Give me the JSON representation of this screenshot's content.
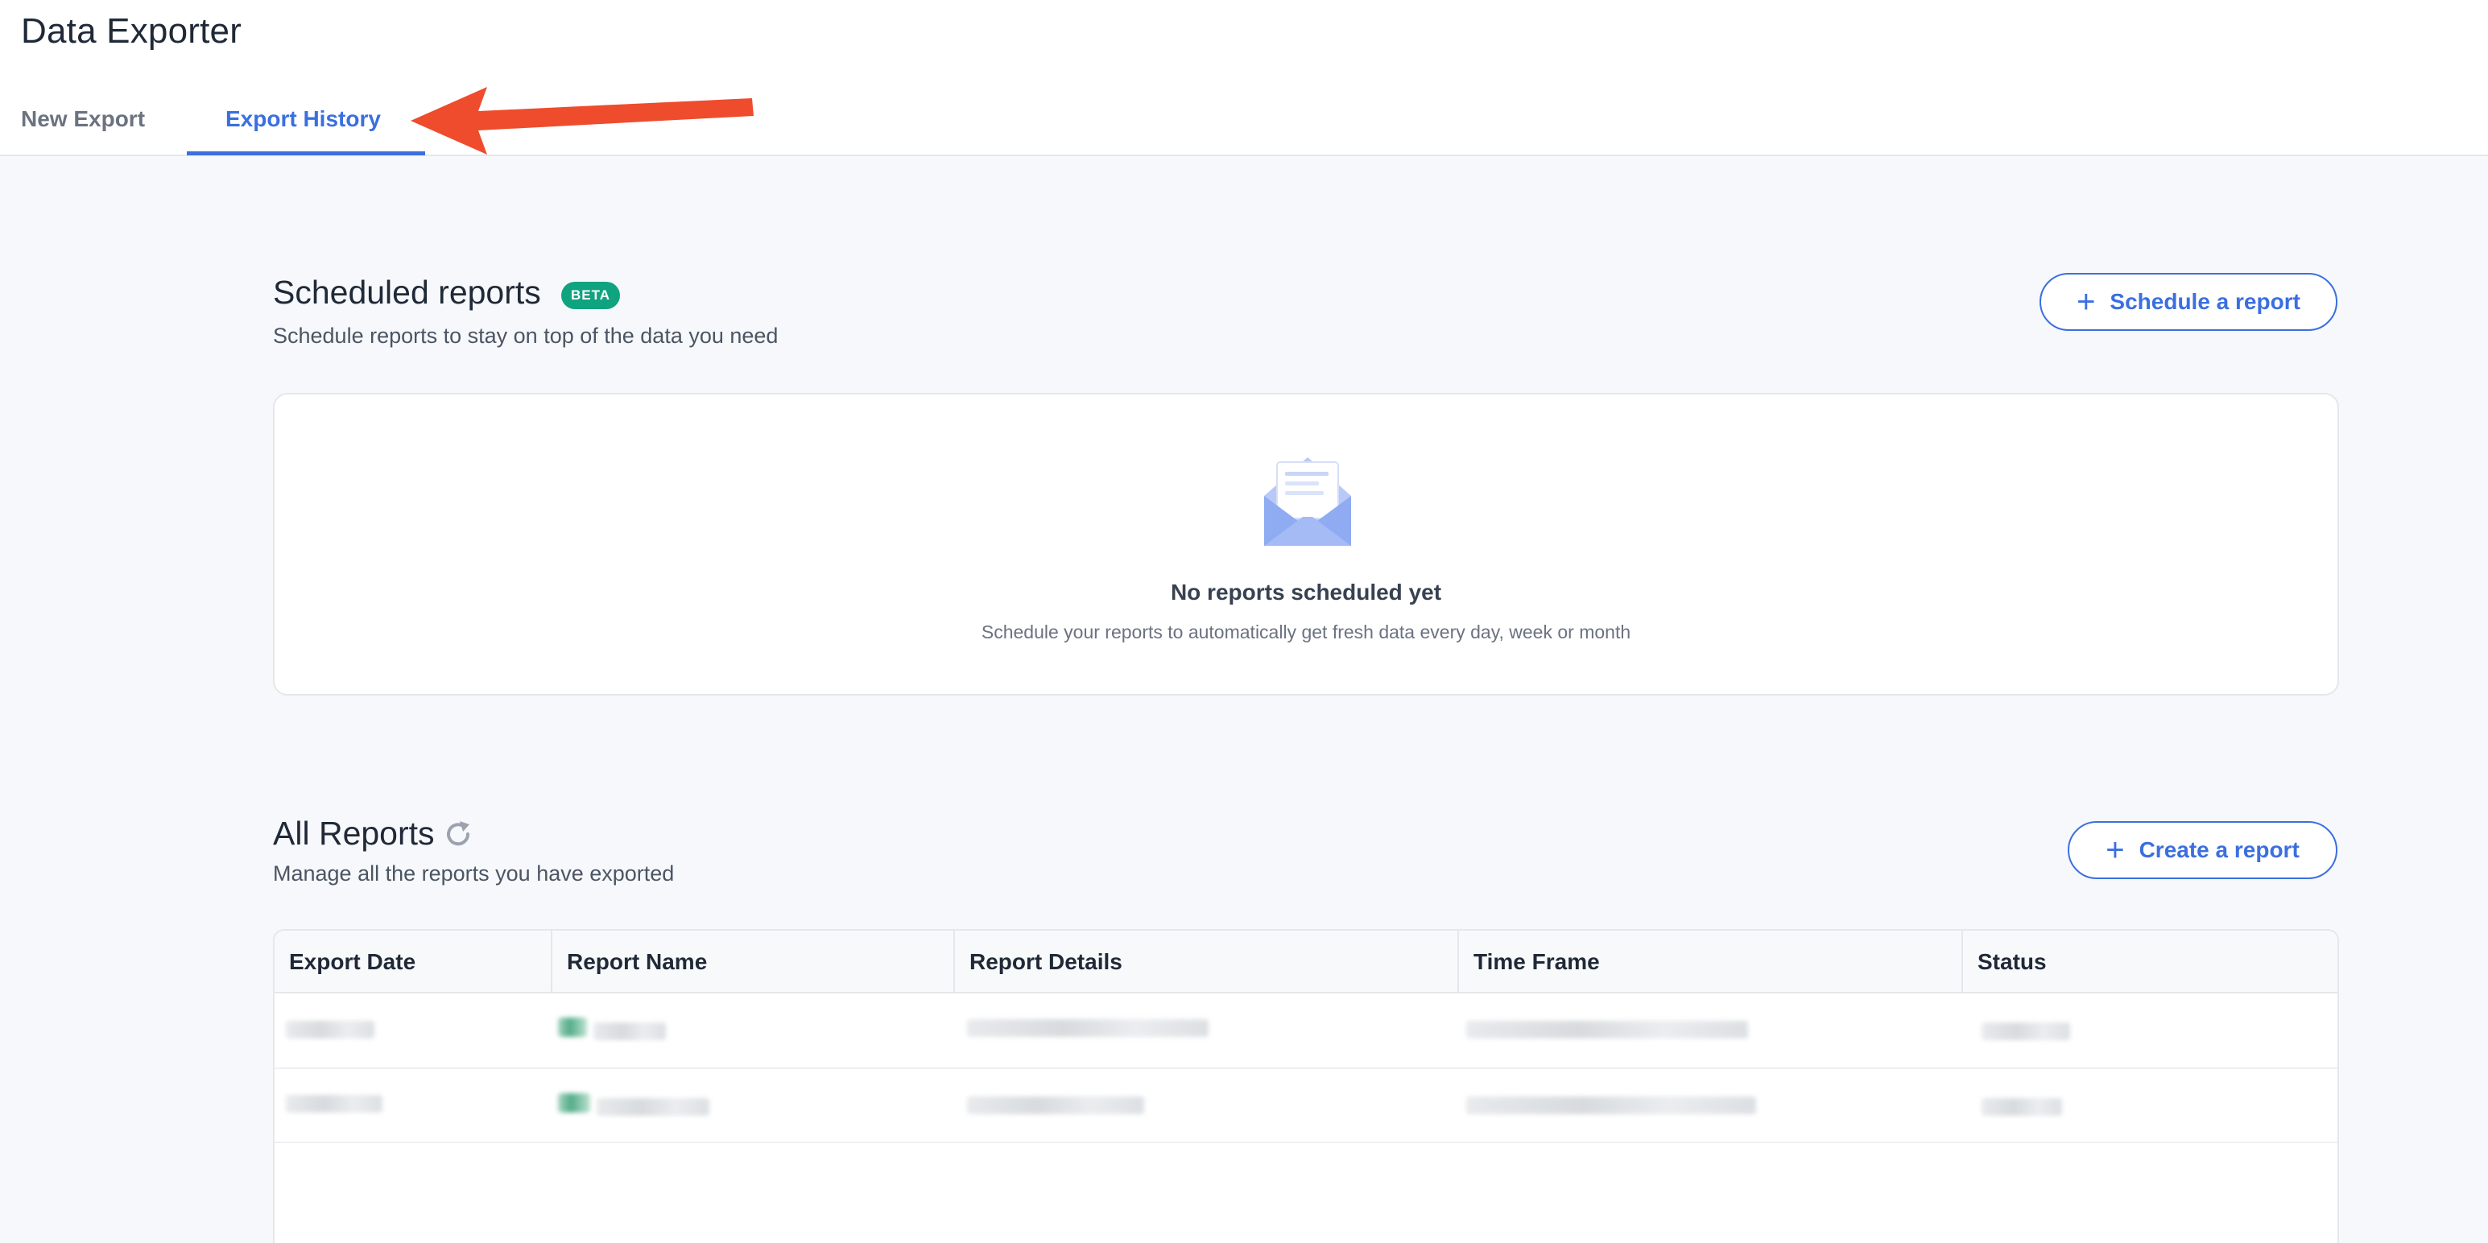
{
  "app": {
    "title": "Data Exporter"
  },
  "tabs": [
    {
      "label": "New Export",
      "active": false
    },
    {
      "label": "Export History",
      "active": true
    }
  ],
  "scheduled": {
    "title": "Scheduled reports",
    "badge": "BETA",
    "subtitle": "Schedule reports to stay on top of the data you need",
    "button_label": "Schedule a report",
    "empty_title": "No reports scheduled yet",
    "empty_subtitle": "Schedule your reports to automatically get fresh data every day, week or month"
  },
  "all_reports": {
    "title": "All Reports",
    "subtitle": "Manage all the reports you have exported",
    "button_label": "Create a report",
    "columns": [
      "Export Date",
      "Report Name",
      "Report Details",
      "Time Frame",
      "Status"
    ]
  },
  "icons": {
    "tab_pointer": "red-arrow-icon",
    "empty_state": "open-envelope-icon",
    "refresh": "refresh-icon",
    "add": "plus-icon"
  },
  "colors": {
    "accent": "#3b6fe0",
    "beta_badge": "#10a37f",
    "annotation_arrow": "#ee4c2c"
  }
}
